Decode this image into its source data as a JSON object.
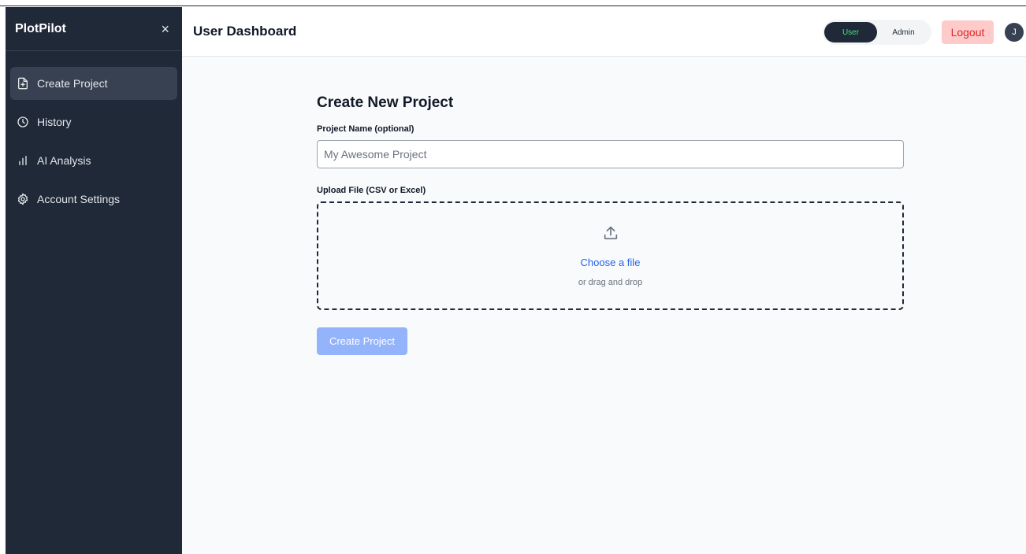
{
  "app": {
    "brand": "PlotPilot",
    "close_glyph": "×"
  },
  "sidebar": {
    "items": [
      {
        "label": "Create Project",
        "icon": "file-plus-icon",
        "active": true
      },
      {
        "label": "History",
        "icon": "clock-icon",
        "active": false
      },
      {
        "label": "AI Analysis",
        "icon": "bar-chart-icon",
        "active": false
      },
      {
        "label": "Account Settings",
        "icon": "gear-icon",
        "active": false
      }
    ]
  },
  "header": {
    "title": "User Dashboard",
    "role_toggle": {
      "user_label": "User",
      "admin_label": "Admin",
      "selected": "User"
    },
    "logout_label": "Logout",
    "avatar_initial": "J"
  },
  "form": {
    "title": "Create New Project",
    "name_label": "Project Name (optional)",
    "name_placeholder": "My Awesome Project",
    "name_value": "",
    "upload_label": "Upload File (CSV or Excel)",
    "upload_link": "Choose a file",
    "upload_hint": "or drag and drop",
    "submit_label": "Create Project"
  },
  "colors": {
    "sidebar_bg": "#1f2937",
    "main_bg": "#f8fafc",
    "accent": "#2563eb",
    "submit_disabled": "#93b4fb",
    "logout_bg": "#fecaca",
    "logout_text": "#dc2626",
    "toggle_active_text": "#4ade80"
  }
}
